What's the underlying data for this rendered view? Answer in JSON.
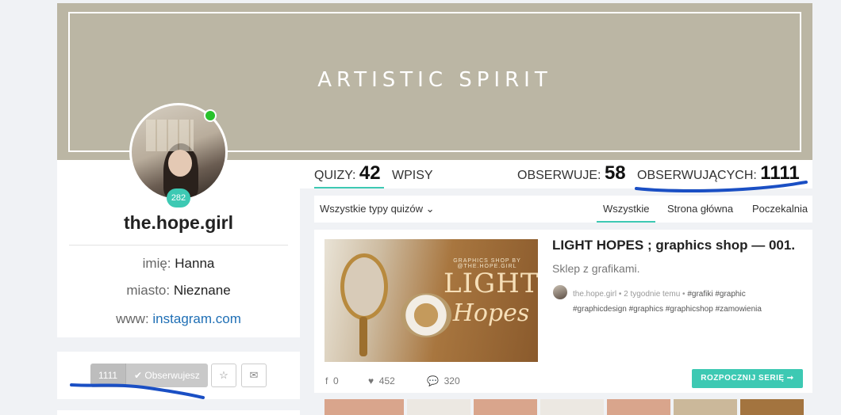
{
  "banner": {
    "title": "ARTISTIC SPIRIT"
  },
  "profile": {
    "username": "the.hope.girl",
    "level": "282",
    "name_label": "imię:",
    "name_value": "Hanna",
    "city_label": "miasto:",
    "city_value": "Nieznane",
    "www_label": "www:",
    "www_value": "instagram.com"
  },
  "actions": {
    "follower_count": "1111",
    "follow_label": "✔ Obserwujesz",
    "star_icon": "☆",
    "mail_icon": "✉"
  },
  "stats": {
    "quizzes_label": "QUIZY:",
    "quizzes_value": "42",
    "posts_label": "WPISY",
    "following_label": "OBSERWUJE:",
    "following_value": "58",
    "followers_label": "OBSERWUJĄCYCH:",
    "followers_value": "1111"
  },
  "filters": {
    "dropdown": "Wszystkie typy quizów  ⌄",
    "tabs": [
      "Wszystkie",
      "Strona główna",
      "Poczekalnia"
    ]
  },
  "quiz": {
    "thumb_small": "GRAPHICS SHOP BY @THE.HOPE.GIRL",
    "thumb_light": "LIGHT",
    "thumb_hopes": "Hopes",
    "title": "LIGHT HOPES ; graphics shop — 001.",
    "description": "Sklep z grafikami.",
    "author": "the.hope.girl",
    "time": "• 2 tygodnie temu •",
    "tags_line1": "#grafiki #graphic",
    "tags_line2": "#graphicdesign #graphics #graphicshop #zamowienia",
    "shares": "0",
    "likes": "452",
    "comments": "320",
    "series_button": "ROZPOCZNIJ SERIĘ ➞"
  },
  "colors": {
    "accent": "#3dc9b3",
    "banner": "#bbb6a4",
    "online": "#28c22c",
    "link": "#1f6fb5",
    "annotation": "#1a4fc4"
  }
}
